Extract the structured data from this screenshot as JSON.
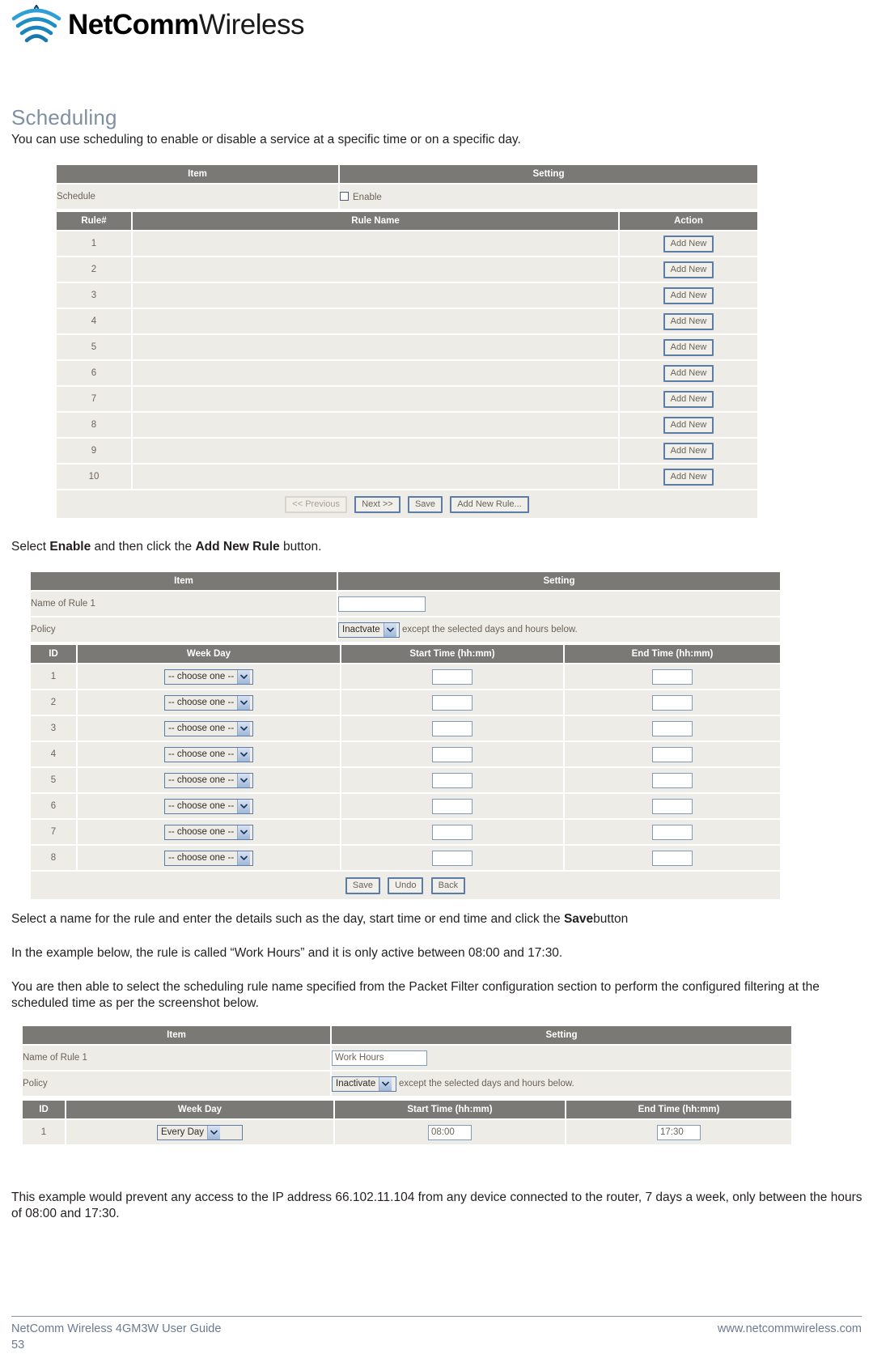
{
  "brand": {
    "name_bold": "NetComm",
    "name_light": "Wireless",
    "logo_icon": "wifi-signal-waves-icon",
    "logo_color": "#2196d3"
  },
  "section": {
    "title": "Scheduling",
    "intro": "You can use scheduling to enable or disable a service at a specific time or on a specific day."
  },
  "schedule_table": {
    "headers": {
      "item": "Item",
      "setting": "Setting"
    },
    "schedule_row": {
      "label": "Schedule",
      "checkbox_label": "Enable",
      "checked": false
    },
    "rule_headers": {
      "rule_num": "Rule#",
      "rule_name": "Rule Name",
      "action": "Action"
    },
    "rows": [
      {
        "id": "1",
        "name": "",
        "action": "Add New"
      },
      {
        "id": "2",
        "name": "",
        "action": "Add New"
      },
      {
        "id": "3",
        "name": "",
        "action": "Add New"
      },
      {
        "id": "4",
        "name": "",
        "action": "Add New"
      },
      {
        "id": "5",
        "name": "",
        "action": "Add New"
      },
      {
        "id": "6",
        "name": "",
        "action": "Add New"
      },
      {
        "id": "7",
        "name": "",
        "action": "Add New"
      },
      {
        "id": "8",
        "name": "",
        "action": "Add New"
      },
      {
        "id": "9",
        "name": "",
        "action": "Add New"
      },
      {
        "id": "10",
        "name": "",
        "action": "Add New"
      }
    ],
    "buttons": {
      "previous": "<< Previous",
      "next": "Next >>",
      "save": "Save",
      "add_new_rule": "Add New Rule..."
    }
  },
  "paragraphs": {
    "p_select_enable_pre": "Select ",
    "p_select_enable_b1": "Enable",
    "p_select_enable_mid": " and then click the ",
    "p_select_enable_b2": "Add New Rule",
    "p_select_enable_post": " button.",
    "p_select_name_pre": "Select a name for the rule and enter the details such as the day, start time or end time and click the ",
    "p_select_name_b": "Save",
    "p_select_name_post": "button",
    "p_example": "In the example below, the rule is called “Work Hours” and it is only active between 08:00 and 17:30.",
    "p_packet_filter": "You are then able to select the scheduling rule name specified from the Packet Filter configuration section to perform the configured filtering at the scheduled time as per the screenshot below.",
    "p_final": "This example would prevent any access to the IP address 66.102.11.104 from any device connected to the router, 7 days a week, only between the hours of 08:00 and 17:30."
  },
  "rule_form_empty": {
    "headers": {
      "item": "Item",
      "setting": "Setting"
    },
    "name_label": "Name of Rule 1",
    "name_value": "",
    "policy_label": "Policy",
    "policy_value": "Inactvate",
    "policy_note": "except the selected days and hours below.",
    "col_headers": {
      "id": "ID",
      "week_day": "Week Day",
      "start_time": "Start Time (hh:mm)",
      "end_time": "End Time (hh:mm)"
    },
    "rows": [
      {
        "id": "1",
        "week_day": "-- choose one --",
        "start": "",
        "end": ""
      },
      {
        "id": "2",
        "week_day": "-- choose one --",
        "start": "",
        "end": ""
      },
      {
        "id": "3",
        "week_day": "-- choose one --",
        "start": "",
        "end": ""
      },
      {
        "id": "4",
        "week_day": "-- choose one --",
        "start": "",
        "end": ""
      },
      {
        "id": "5",
        "week_day": "-- choose one --",
        "start": "",
        "end": ""
      },
      {
        "id": "6",
        "week_day": "-- choose one --",
        "start": "",
        "end": ""
      },
      {
        "id": "7",
        "week_day": "-- choose one --",
        "start": "",
        "end": ""
      },
      {
        "id": "8",
        "week_day": "-- choose one --",
        "start": "",
        "end": ""
      }
    ],
    "buttons": {
      "save": "Save",
      "undo": "Undo",
      "back": "Back"
    }
  },
  "rule_form_filled": {
    "headers": {
      "item": "Item",
      "setting": "Setting"
    },
    "name_label": "Name of Rule 1",
    "name_value": "Work Hours",
    "policy_label": "Policy",
    "policy_value": "Inactivate",
    "policy_note": "except the selected days and hours below.",
    "col_headers": {
      "id": "ID",
      "week_day": "Week Day",
      "start_time": "Start Time (hh:mm)",
      "end_time": "End Time (hh:mm)"
    },
    "rows": [
      {
        "id": "1",
        "week_day": "Every Day",
        "start": "08:00",
        "end": "17:30"
      }
    ]
  },
  "footer": {
    "left": "NetComm Wireless 4GM3W User Guide",
    "page": "53",
    "right": "www.netcommwireless.com"
  }
}
